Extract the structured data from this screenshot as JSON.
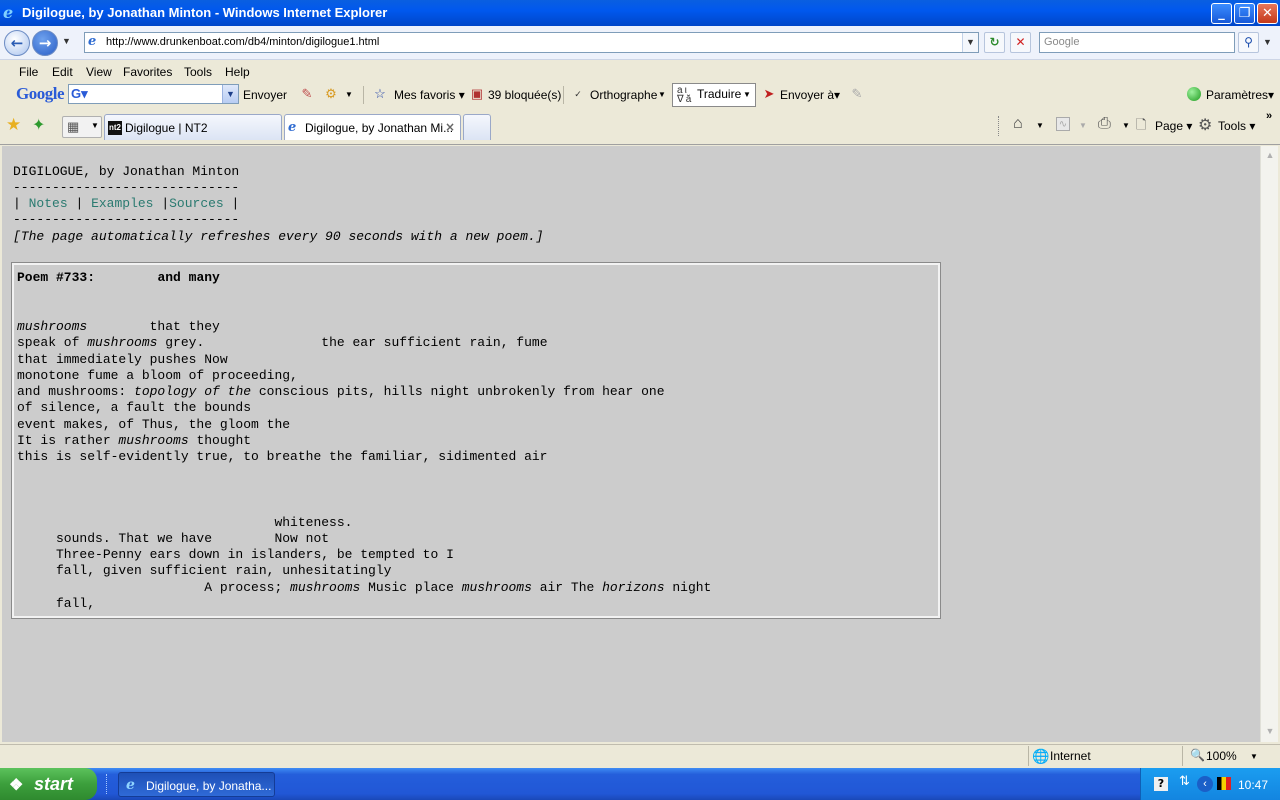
{
  "window": {
    "title": "Digilogue, by Jonathan Minton - Windows Internet Explorer",
    "min": "_",
    "max": "❐",
    "close": "✕"
  },
  "address": {
    "url": "http://www.drunkenboat.com/db4/minton/digilogue1.html",
    "search_placeholder": "Google"
  },
  "menu": [
    "File",
    "Edit",
    "View",
    "Favorites",
    "Tools",
    "Help"
  ],
  "google_toolbar": {
    "logo": "Google",
    "envoyer": "Envoyer",
    "mes_favoris": "Mes favoris",
    "bloquees": "39 bloquée(s)",
    "orthographe": "Orthographe",
    "traduire": "Traduire",
    "envoyer_a": "Envoyer à",
    "parametres": "Paramètres"
  },
  "tabs": [
    {
      "label": "Digilogue | NT2",
      "active": false
    },
    {
      "label": "Digilogue, by Jonathan Mi...",
      "active": true
    }
  ],
  "command_bar": {
    "page": "Page",
    "tools": "Tools"
  },
  "page": {
    "heading": "DIGILOGUE, by Jonathan Minton",
    "rule": "-----------------------------",
    "nav": {
      "sep": "|",
      "notes": "Notes",
      "examples": "Examples",
      "sources": "Sources"
    },
    "refresh_note": "[The page automatically refreshes every 90 seconds with a new poem.]",
    "poem": {
      "number": "Poem #733:",
      "title": "and many",
      "lines": [
        {
          "parts": [
            {
              "t": "mushrooms",
              "i": true
            },
            {
              "t": "        that they"
            }
          ]
        },
        {
          "parts": [
            {
              "t": "speak of "
            },
            {
              "t": "mushrooms",
              "i": true
            },
            {
              "t": " grey.               the ear sufficient rain, fume"
            }
          ]
        },
        {
          "parts": [
            {
              "t": "that immediately pushes Now"
            }
          ]
        },
        {
          "parts": [
            {
              "t": "monotone fume a bloom of proceeding,"
            }
          ]
        },
        {
          "parts": [
            {
              "t": "and mushrooms: "
            },
            {
              "t": "topology of the",
              "i": true
            },
            {
              "t": " conscious pits, hills night unbrokenly from hear one"
            }
          ]
        },
        {
          "parts": [
            {
              "t": "of silence, a fault the bounds"
            }
          ]
        },
        {
          "parts": [
            {
              "t": "event makes, of Thus, the gloom the"
            }
          ]
        },
        {
          "parts": [
            {
              "t": "It is rather "
            },
            {
              "t": "mushrooms",
              "i": true
            },
            {
              "t": " thought"
            }
          ]
        },
        {
          "parts": [
            {
              "t": "this is self-evidently true, to breathe the familiar, sidimented air"
            }
          ]
        },
        {
          "parts": [
            {
              "t": ""
            }
          ]
        },
        {
          "parts": [
            {
              "t": ""
            }
          ]
        },
        {
          "parts": [
            {
              "t": ""
            }
          ]
        },
        {
          "parts": [
            {
              "t": "                                 whiteness."
            }
          ]
        },
        {
          "parts": [
            {
              "t": "     sounds. That we have        Now not"
            }
          ]
        },
        {
          "parts": [
            {
              "t": "     Three-Penny ears down in islanders, be tempted to I"
            }
          ]
        },
        {
          "parts": [
            {
              "t": "     fall, given sufficient rain, unhesitatingly"
            }
          ]
        },
        {
          "parts": [
            {
              "t": "                        A process; "
            },
            {
              "t": "mushrooms",
              "i": true
            },
            {
              "t": " Music place "
            },
            {
              "t": "mushrooms",
              "i": true
            },
            {
              "t": " air The "
            },
            {
              "t": "horizons",
              "i": true
            },
            {
              "t": " night"
            }
          ]
        },
        {
          "parts": [
            {
              "t": "     fall,"
            }
          ]
        }
      ]
    }
  },
  "status": {
    "zone": "Internet",
    "zoom": "100%"
  },
  "taskbar": {
    "start": "start",
    "item": "Digilogue, by Jonatha...",
    "clock": "10:47"
  }
}
